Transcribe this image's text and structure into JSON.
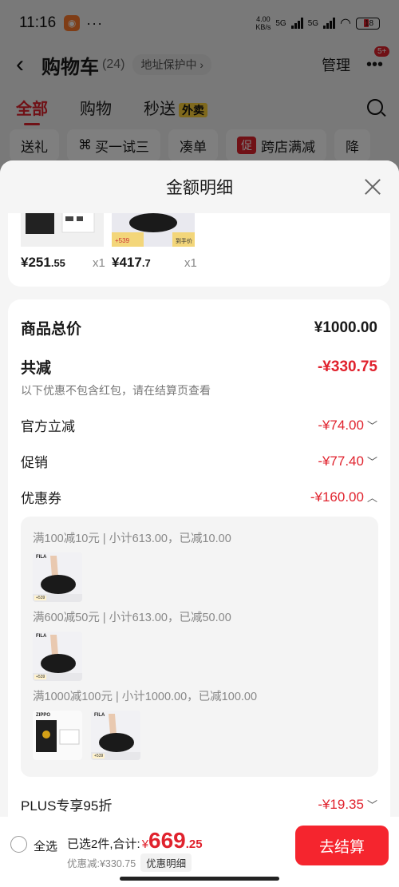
{
  "status_bar": {
    "time": "11:16",
    "dots": "···",
    "speed_value": "4.00",
    "speed_unit": "KB/s",
    "net1": "5G",
    "net2": "5G",
    "battery": "18"
  },
  "nav": {
    "title": "购物车",
    "count": "(24)",
    "address_protect": "地址保护中 ›",
    "manage": "管理",
    "more_badge": "5+"
  },
  "tabs": {
    "all": "全部",
    "shopping": "购物",
    "flash": "秒送",
    "flash_tag": "外卖"
  },
  "chips": [
    "送礼",
    "买一试三",
    "凑单",
    "跨店满减",
    "降"
  ],
  "chip_promo_icon": "促",
  "sheet": {
    "title": "金额明细"
  },
  "products": [
    {
      "price_int": "¥251",
      "price_dec": ".55",
      "qty": "x1"
    },
    {
      "price_int": "¥417",
      "price_dec": ".7",
      "qty": "x1"
    }
  ],
  "product_image_texts": {
    "plus_price": "+539",
    "plus_note": "到手价"
  },
  "summary": {
    "total_label": "商品总价",
    "total_value": "¥1000.00",
    "reduce_label": "共减",
    "reduce_value": "-¥330.75",
    "note": "以下优惠不包含红包，请在结算页查看",
    "items": [
      {
        "label": "官方立减",
        "value": "-¥74.00",
        "chevron": "﹀"
      },
      {
        "label": "促销",
        "value": "-¥77.40",
        "chevron": "﹀"
      },
      {
        "label": "优惠券",
        "value": "-¥160.00",
        "chevron": "︿"
      }
    ],
    "plus_label": "PLUS专享95折",
    "plus_value": "-¥19.35",
    "plus_chevron": "﹀"
  },
  "coupons": [
    {
      "text": "满100减10元 | 小计613.00，已减10.00"
    },
    {
      "text": "满600减50元 | 小计613.00，已减50.00"
    },
    {
      "text": "满1000减100元 | 小计1000.00，已减100.00"
    }
  ],
  "thumb_texts": {
    "brand_fila": "FILA",
    "brand_zippo": "ZIPPO",
    "tag": "+539"
  },
  "bottom": {
    "select_all": "全选",
    "selected_text": "已选2件,合计:",
    "currency": "¥",
    "total_int": "669",
    "total_dec": ".25",
    "discount_text": "优惠减:¥330.75",
    "detail_btn": "优惠明细",
    "checkout": "去结算"
  },
  "colors": {
    "accent": "#e0222d",
    "checkout": "#f5252e"
  }
}
